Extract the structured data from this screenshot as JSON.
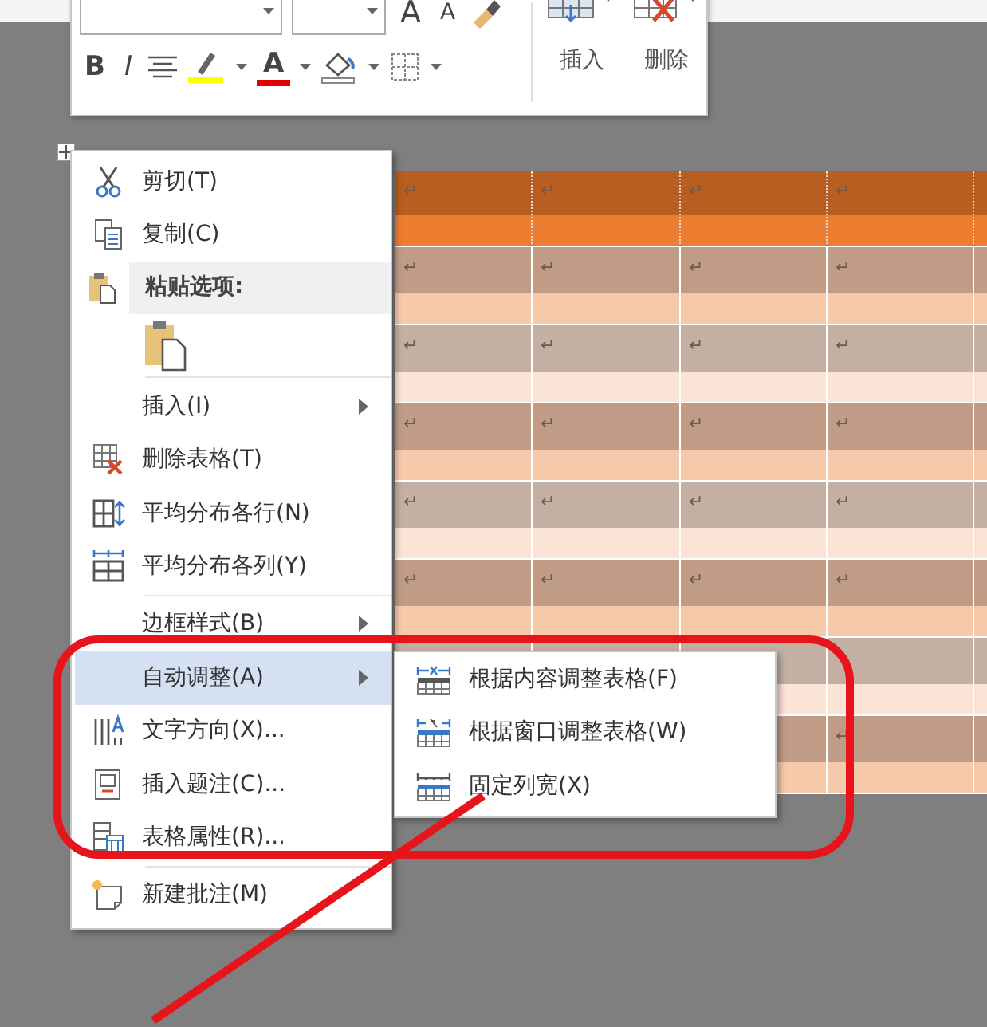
{
  "mini_toolbar": {
    "grow_font": "A",
    "shrink_font": "A",
    "bold": "B",
    "italic": "I",
    "font_color": "A",
    "insert": "插入",
    "delete": "删除"
  },
  "table": {
    "rows": [
      {
        "kind": "header",
        "cells": [
          "↵",
          "↵",
          "↵",
          "↵"
        ]
      },
      {
        "kind": "odd",
        "cells": [
          "↵",
          "↵",
          "↵",
          "↵"
        ]
      },
      {
        "kind": "even",
        "cells": [
          "↵",
          "↵",
          "↵",
          "↵"
        ]
      },
      {
        "kind": "odd",
        "cells": [
          "↵",
          "↵",
          "↵",
          "↵"
        ]
      },
      {
        "kind": "even",
        "cells": [
          "↵",
          "↵",
          "↵",
          "↵"
        ]
      },
      {
        "kind": "odd",
        "cells": [
          "↵",
          "↵",
          "↵",
          "↵"
        ]
      },
      {
        "kind": "even",
        "cells": [
          null,
          null,
          null,
          null
        ]
      },
      {
        "kind": "odd",
        "cells": [
          null,
          null,
          null,
          "↵"
        ]
      }
    ]
  },
  "context_menu": {
    "items": [
      {
        "kind": "item",
        "label": "剪切(T)",
        "submenu": false,
        "selected": false
      },
      {
        "kind": "item",
        "label": "复制(C)",
        "submenu": false,
        "selected": false
      },
      {
        "kind": "header",
        "label": "粘贴选项:"
      },
      {
        "kind": "paste_options"
      },
      {
        "kind": "separator"
      },
      {
        "kind": "item",
        "label": "插入(I)",
        "submenu": true,
        "selected": false
      },
      {
        "kind": "item",
        "label": "删除表格(T)",
        "submenu": false,
        "selected": false
      },
      {
        "kind": "item",
        "label": "平均分布各行(N)",
        "submenu": false,
        "selected": false
      },
      {
        "kind": "item",
        "label": "平均分布各列(Y)",
        "submenu": false,
        "selected": false
      },
      {
        "kind": "separator"
      },
      {
        "kind": "item",
        "label": "边框样式(B)",
        "submenu": true,
        "selected": false
      },
      {
        "kind": "item",
        "label": "自动调整(A)",
        "submenu": true,
        "selected": true
      },
      {
        "kind": "item",
        "label": "文字方向(X)...",
        "submenu": false,
        "selected": false
      },
      {
        "kind": "item",
        "label": "插入题注(C)...",
        "submenu": false,
        "selected": false
      },
      {
        "kind": "item",
        "label": "表格属性(R)...",
        "submenu": false,
        "selected": false
      },
      {
        "kind": "separator"
      },
      {
        "kind": "item",
        "label": "新建批注(M)",
        "submenu": false,
        "selected": false
      }
    ]
  },
  "submenu": {
    "items": [
      {
        "label": "根据内容调整表格(F)",
        "selected": false
      },
      {
        "label": "根据窗口调整表格(W)",
        "selected": false
      },
      {
        "label": "固定列宽(X)",
        "selected": false
      }
    ]
  }
}
